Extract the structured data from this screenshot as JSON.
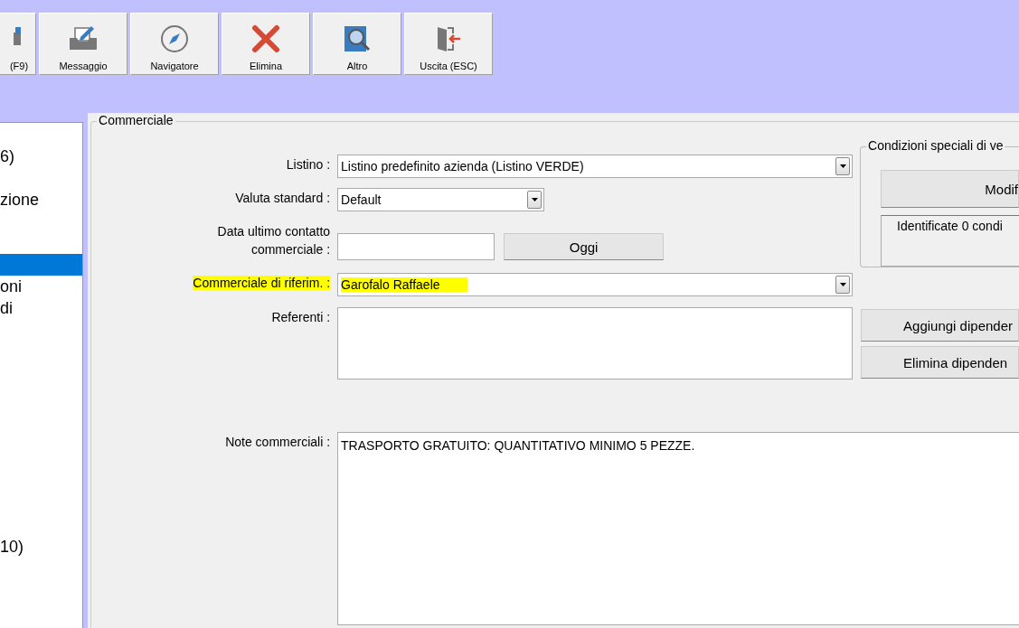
{
  "toolbar": {
    "buttons": [
      {
        "label": "(F9)"
      },
      {
        "label": "Messaggio"
      },
      {
        "label": "Navigatore"
      },
      {
        "label": "Elimina"
      },
      {
        "label": "Altro"
      },
      {
        "label": "Uscita (ESC)"
      }
    ]
  },
  "sidebar": {
    "items": [
      {
        "label": "6)",
        "selected": false
      },
      {
        "label": "zione",
        "selected": false
      },
      {
        "selected": true
      },
      {
        "label": "oni",
        "selected": false
      },
      {
        "label": "di",
        "selected": false
      },
      {
        "label": "10)",
        "selected": false
      }
    ]
  },
  "commerciale": {
    "title": "Commerciale",
    "listino": {
      "label": "Listino :",
      "value": "Listino predefinito azienda (Listino VERDE)"
    },
    "valuta": {
      "label": "Valuta standard :",
      "value": "Default"
    },
    "data_contatto": {
      "label": "Data ultimo contatto commerciale :",
      "button": "Oggi"
    },
    "commerciale_rif": {
      "label": "Commerciale di riferim. :",
      "value": "Garofalo Raffaele",
      "highlighted": true
    },
    "referenti": {
      "label": "Referenti :"
    },
    "note": {
      "label": "Note commerciali :",
      "value": "TRASPORTO GRATUITO: QUANTITATIVO MINIMO 5 PEZZE."
    },
    "condizioni": {
      "title": "Condizioni speciali di ve",
      "button": "Modif",
      "info": "Identificate 0 condi"
    },
    "dipendenti_buttons": [
      "Aggiungi dipender",
      "Elimina dipenden"
    ]
  }
}
